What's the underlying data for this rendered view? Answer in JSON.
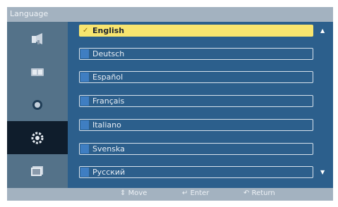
{
  "window": {
    "title": "Language"
  },
  "sidebar": {
    "items": [
      {
        "icon": "picture-icon"
      },
      {
        "icon": "sound-icon"
      },
      {
        "icon": "setup-icon"
      },
      {
        "icon": "settings-icon"
      },
      {
        "icon": "multi-control-icon"
      }
    ],
    "active_index": 3
  },
  "language_list": {
    "selected_index": 0,
    "options": [
      {
        "label": "English"
      },
      {
        "label": "Deutsch"
      },
      {
        "label": "Español"
      },
      {
        "label": "Français"
      },
      {
        "label": "Italiano"
      },
      {
        "label": "Svenska"
      },
      {
        "label": "Русский"
      }
    ],
    "check_mark": "✓",
    "scroll_up": "▲",
    "scroll_down": "▼"
  },
  "footer": {
    "move_icon": "⇕",
    "move_label": "Move",
    "enter_icon": "↵",
    "enter_label": "Enter",
    "return_icon": "↶",
    "return_label": "Return"
  },
  "colors": {
    "selected": "#f8e56f",
    "content_bg": "#2c5f8c",
    "sidebar_bg": "#547289",
    "bar_bg": "#a3b2c0"
  }
}
